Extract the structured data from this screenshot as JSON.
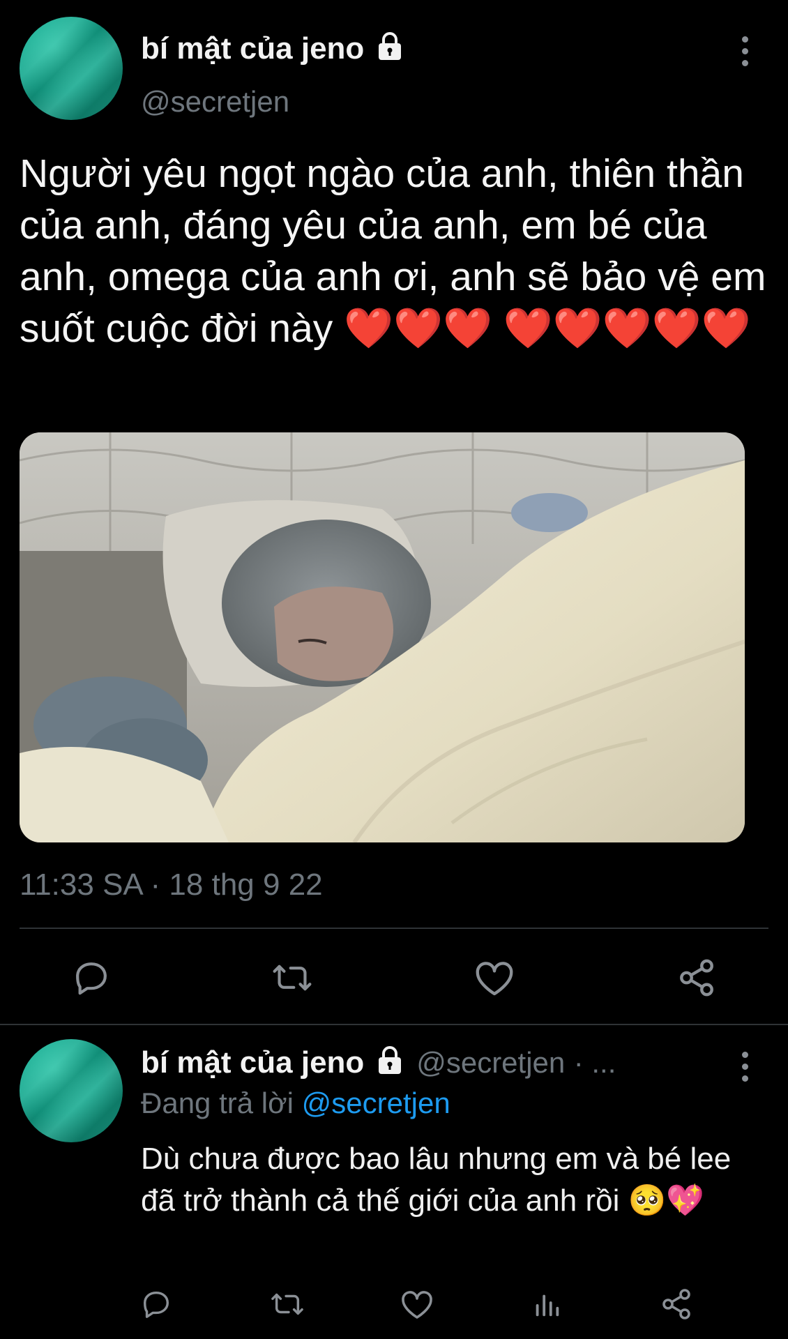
{
  "tweet": {
    "author_name": "bí mật của jeno",
    "author_handle": "@secretjen",
    "text": "Người yêu ngọt ngào của anh, thiên thần của anh, đáng yêu của anh, em bé của anh, omega của anh ơi, anh sẽ bảo vệ em suốt cuộc đời này ❤️❤️❤️ ❤️❤️❤️❤️❤️",
    "timestamp": "11:33 SA · 18 thg 9 22",
    "image_alt": "photo",
    "actions": [
      "reply-icon",
      "retweet-icon",
      "like-icon",
      "share-icon"
    ]
  },
  "reply": {
    "author_name": "bí mật của jeno",
    "author_handle": "@secretjen",
    "time_sep": "· ...",
    "replying_label": "Đang trả lời",
    "replying_to": "@secretjen",
    "text": "Dù chưa được bao lâu nhưng em và bé lee đã trở thành cả thế giới của anh rồi 🥺💖",
    "actions": [
      "reply-icon",
      "retweet-icon",
      "like-icon",
      "views-icon",
      "share-icon"
    ]
  },
  "colors": {
    "background": "#000000",
    "muted": "#6e767d",
    "link": "#1d9bf0",
    "avatar": "#14a88e"
  }
}
